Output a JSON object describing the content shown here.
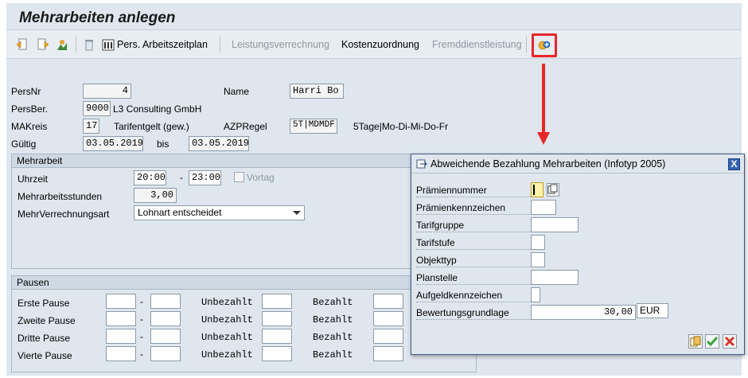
{
  "title": "Mehrarbeiten anlegen",
  "toolbar": {
    "icons": [
      "previous-record-icon",
      "next-record-icon",
      "overview-icon",
      "delete-icon",
      "calendar-icon",
      "create-record-icon"
    ],
    "pers_arbeitszeitplan": "Pers. Arbeitszeitplan",
    "leistungsverrechnung": "Leistungsverrechnung",
    "kostenzuordnung": "Kostenzuordnung",
    "fremddienstleistung": "Fremddienstleistung"
  },
  "header": {
    "persnr_label": "PersNr",
    "persnr_value": "4",
    "name_label": "Name",
    "name_value": "Harri Bo",
    "persber_label": "PersBer.",
    "persber_value": "9000",
    "persber_text": "L3 Consulting GmbH",
    "makreis_label": "MAKreis",
    "makreis_value": "17",
    "makreis_text": "Tarifentgelt (gew.)",
    "azpregel_label": "AZPRegel",
    "azpregel_value": "5T|MDMDF",
    "azpregel_text": "5Tage|Mo-Di-Mi-Do-Fr",
    "gueltig_label": "Gültig",
    "gueltig_from": "03.05.2019",
    "bis_label": "bis",
    "gueltig_to": "03.05.2019"
  },
  "mehrarbeit": {
    "heading": "Mehrarbeit",
    "uhrzeit_label": "Uhrzeit",
    "uhrzeit_from": "20:00",
    "dash": "-",
    "uhrzeit_to": "23:00",
    "vortag_label": "Vortag",
    "stunden_label": "Mehrarbeitsstunden",
    "stunden_value": "3,00",
    "verrechnung_label": "MehrVerrechnungsart",
    "verrechnung_value": "Lohnart entscheidet"
  },
  "pausen": {
    "heading": "Pausen",
    "dash": "-",
    "unbezahlt_label": "Unbezahlt",
    "bezahlt_label": "Bezahlt",
    "rows": [
      "Erste Pause",
      "Zweite Pause",
      "Dritte Pause",
      "Vierte Pause"
    ]
  },
  "dialog": {
    "title": "Abweichende Bezahlung Mehrarbeiten (Infotyp 2005)",
    "close": "X",
    "fields": [
      {
        "label": "Prämiennummer",
        "value": ""
      },
      {
        "label": "Prämienkennzeichen",
        "value": ""
      },
      {
        "label": "Tarifgruppe",
        "value": ""
      },
      {
        "label": "Tarifstufe",
        "value": ""
      },
      {
        "label": "Objekttyp",
        "value": ""
      },
      {
        "label": "Planstelle",
        "value": ""
      },
      {
        "label": "Aufgeldkennzeichen",
        "value": ""
      },
      {
        "label": "Bewertungsgrundlage",
        "value": "30,00"
      }
    ],
    "currency": "EUR",
    "buttons": [
      "search-help-icon",
      "confirm-icon",
      "cancel-icon"
    ]
  },
  "colors": {
    "highlight": "#e8262a",
    "dialog_close": "#3464b4",
    "confirm": "#3aa53a",
    "cancel": "#d9342b"
  }
}
